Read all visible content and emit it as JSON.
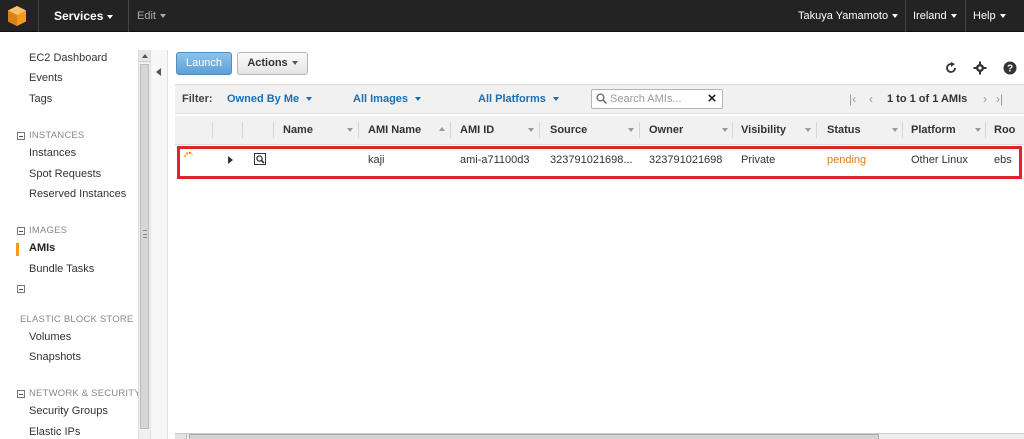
{
  "topbar": {
    "services": "Services",
    "edit": "Edit",
    "user": "Takuya Yamamoto",
    "region": "Ireland",
    "help": "Help"
  },
  "sidebar": {
    "items": {
      "ec2_dashboard": "EC2 Dashboard",
      "events": "Events",
      "tags": "Tags",
      "instances_head": "INSTANCES",
      "instances": "Instances",
      "spot_requests": "Spot Requests",
      "reserved_instances": "Reserved Instances",
      "images_head": "IMAGES",
      "amis": "AMIs",
      "bundle_tasks": "Bundle Tasks",
      "ebs_head": "ELASTIC BLOCK STORE",
      "volumes": "Volumes",
      "snapshots": "Snapshots",
      "network_head": "NETWORK & SECURITY",
      "security_groups": "Security Groups",
      "elastic_ips": "Elastic IPs"
    }
  },
  "toolbar": {
    "launch": "Launch",
    "actions": "Actions"
  },
  "filter": {
    "label": "Filter:",
    "owned_by": "Owned By Me",
    "images": "All Images",
    "platforms": "All Platforms",
    "search_placeholder": "Search AMIs...",
    "pager": "1 to 1 of 1 AMIs"
  },
  "table": {
    "columns": {
      "name": "Name",
      "ami_name": "AMI Name",
      "ami_id": "AMI ID",
      "source": "Source",
      "owner": "Owner",
      "visibility": "Visibility",
      "status": "Status",
      "platform": "Platform",
      "root": "Roo"
    },
    "rows": [
      {
        "name": "",
        "ami_name": "kaji",
        "ami_id": "ami-a71100d3",
        "source": "323791021698...",
        "owner": "323791021698",
        "visibility": "Private",
        "status": "pending",
        "platform": "Other Linux",
        "root": "ebs"
      }
    ]
  },
  "colors": {
    "accent": "#1a6fb5",
    "pending": "#e47911",
    "highlight": "#e2232a",
    "active_marker": "#f29b1d"
  }
}
